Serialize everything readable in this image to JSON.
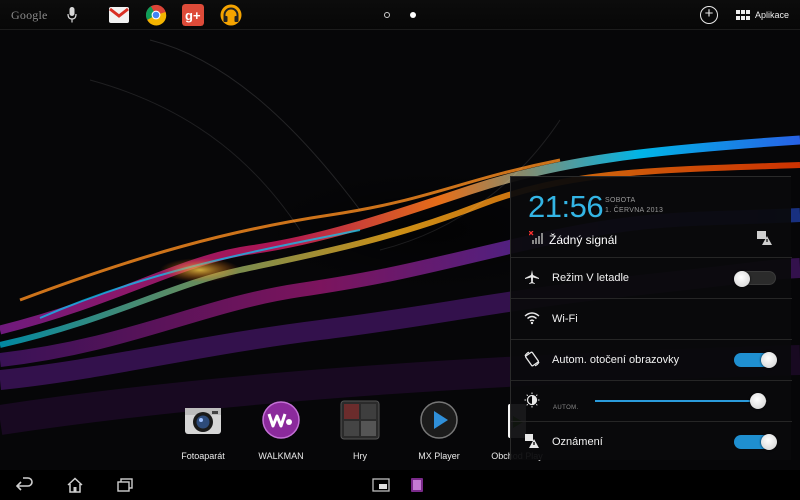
{
  "topbar": {
    "search_label": "Google",
    "apps_label": "Aplikace",
    "pinned_apps": [
      {
        "icon": "gmail-icon",
        "color": "#d93025"
      },
      {
        "icon": "chrome-icon",
        "color": "#4285f4"
      },
      {
        "icon": "google-plus-icon",
        "color": "#dd4b39"
      },
      {
        "icon": "headphones-icon",
        "color": "#f4a300"
      }
    ],
    "page_indicator": {
      "pages": 2,
      "current": 2
    }
  },
  "dock": [
    {
      "label": "Fotoaparát",
      "icon": "camera-icon"
    },
    {
      "label": "WALKMAN",
      "icon": "walkman-icon"
    },
    {
      "label": "Hry",
      "icon": "games-icon"
    },
    {
      "label": "MX Player",
      "icon": "play-icon"
    },
    {
      "label": "Obchod Play",
      "icon": "play-store-icon"
    }
  ],
  "panel": {
    "time": "21:56",
    "day": "SOBOTA",
    "date": "1. ČERVNA 2013",
    "signal_text": "Žádný signál",
    "rows": [
      {
        "label": "Režim V letadle",
        "icon": "airplane-icon",
        "toggle": "off"
      },
      {
        "label": "Wi-Fi",
        "icon": "wifi-icon"
      },
      {
        "label": "Autom. otočení obrazovky",
        "icon": "rotate-icon",
        "toggle": "on"
      },
      {
        "label": "AUTOM.",
        "icon": "brightness-icon",
        "brightness": 0.95
      },
      {
        "label": "Oznámení",
        "icon": "notification-icon",
        "toggle": "on"
      }
    ]
  },
  "colors": {
    "accent": "#33b5e5",
    "toggle_on": "#1f8fd0"
  }
}
